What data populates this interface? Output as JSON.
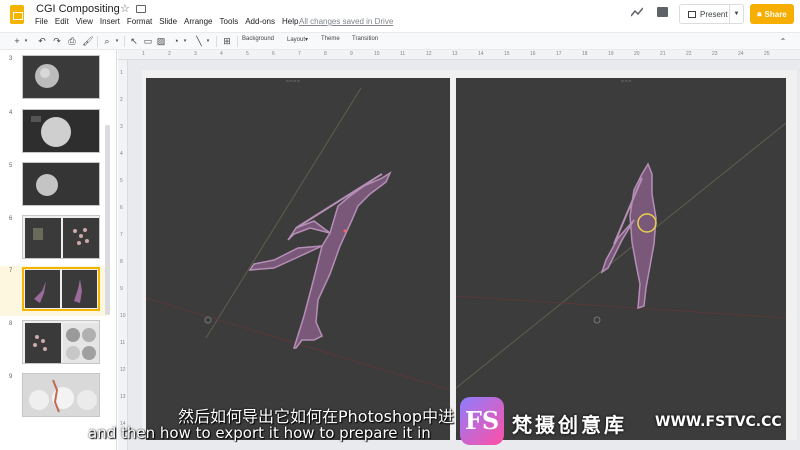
{
  "app": {
    "doc_title": "CGI Compositing",
    "menu": [
      "File",
      "Edit",
      "View",
      "Insert",
      "Format",
      "Slide",
      "Arrange",
      "Tools",
      "Add-ons",
      "Help"
    ],
    "saved_status": "All changes saved in Drive",
    "present_label": "Present",
    "share_label": "Share",
    "brand_color": "#f4b400",
    "share_color": "#f6ae00"
  },
  "toolbar": {
    "background_label": "Background",
    "layout_label": "Layout",
    "theme_label": "Theme",
    "transition_label": "Transition",
    "icons": [
      "add-icon",
      "undo-icon",
      "redo-icon",
      "print-icon",
      "paint-format-icon",
      "zoom-icon",
      "select-icon",
      "textbox-icon",
      "image-icon",
      "shape-icon",
      "line-icon",
      "comment-add-icon"
    ]
  },
  "filmstrip": {
    "slides": [
      {
        "number": "3"
      },
      {
        "number": "4"
      },
      {
        "number": "5"
      },
      {
        "number": "6"
      },
      {
        "number": "7"
      },
      {
        "number": "8"
      },
      {
        "number": "9"
      }
    ],
    "selected": "7"
  },
  "ruler": {
    "top": [
      "1",
      "2",
      "3",
      "4",
      "5",
      "6",
      "7",
      "8",
      "9",
      "10",
      "11",
      "12",
      "13",
      "14",
      "15",
      "16",
      "17",
      "18",
      "19",
      "20",
      "21",
      "22",
      "23",
      "24",
      "25"
    ],
    "left": [
      "1",
      "2",
      "3",
      "4",
      "5",
      "6",
      "7",
      "8",
      "9",
      "10",
      "11",
      "12",
      "13",
      "14"
    ]
  },
  "subtitles": {
    "chinese": "然后如何导出它如何在Photoshop中进",
    "english": "and then how to export it how to prepare it in"
  },
  "watermark": {
    "logo_text": "FS",
    "name": "梵摄创意库",
    "url": "WWW.FSTVC.CC"
  }
}
